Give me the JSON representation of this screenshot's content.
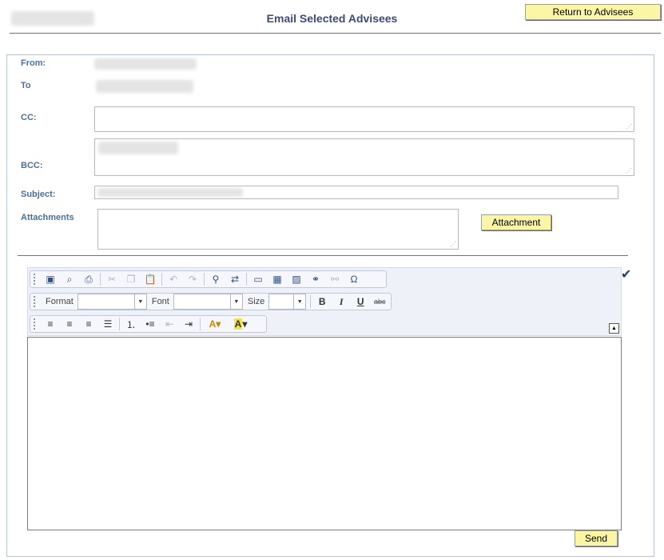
{
  "header": {
    "title": "Email Selected Advisees",
    "return_label": "Return to Advisees"
  },
  "form": {
    "from_label": "From:",
    "to_label": "To",
    "cc_label": "CC:",
    "bcc_label": "BCC:",
    "subject_label": "Subject:",
    "attachments_label": "Attachments",
    "attachment_button": "Attachment",
    "cc_value": "",
    "subject_value": ""
  },
  "toolbar": {
    "format_label": "Format",
    "font_label": "Font",
    "size_label": "Size",
    "format_value": "",
    "font_value": "",
    "size_value": "",
    "icons": {
      "row1": [
        "source-icon",
        "preview-icon",
        "print-icon",
        "cut-icon",
        "copy-icon",
        "paste-icon",
        "undo-icon",
        "redo-icon",
        "find-icon",
        "replace-icon",
        "horizontal-rule-icon",
        "table-icon",
        "image-icon",
        "link-icon",
        "unlink-icon",
        "special-char-icon"
      ],
      "row2": [
        "bold-icon",
        "italic-icon",
        "underline-icon",
        "strikethrough-icon"
      ],
      "row3": [
        "align-left-icon",
        "align-center-icon",
        "align-right-icon",
        "justify-icon",
        "numbered-list-icon",
        "bulleted-list-icon",
        "outdent-icon",
        "indent-icon",
        "text-color-icon",
        "background-color-icon"
      ]
    }
  },
  "footer": {
    "send_label": "Send"
  },
  "colors": {
    "title": "#3c4a78",
    "label": "#4a6f99",
    "button_bg": "#fbf6a6"
  }
}
